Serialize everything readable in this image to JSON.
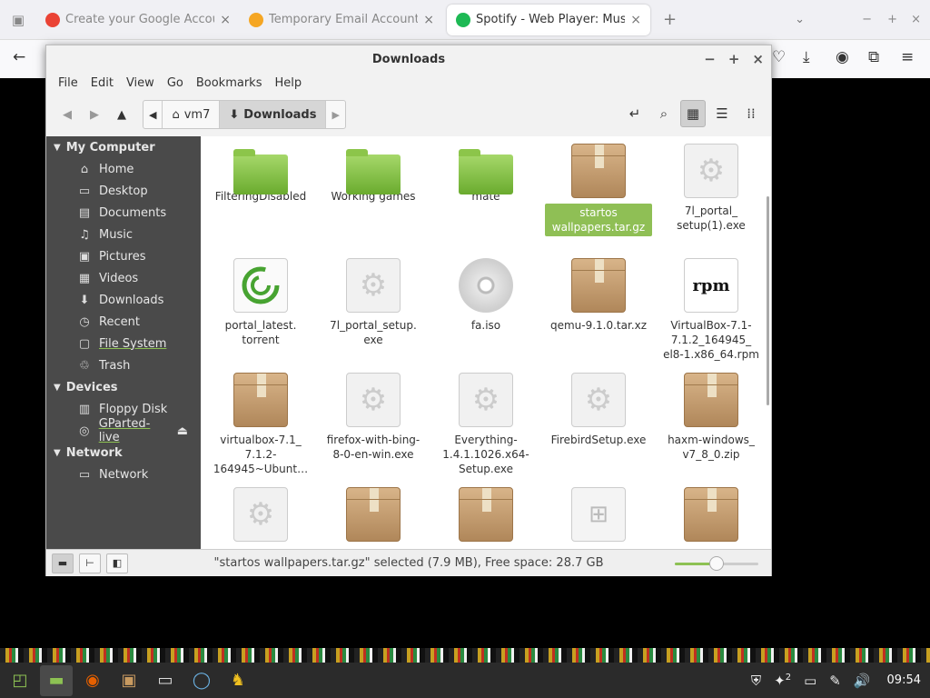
{
  "browser": {
    "tabs": [
      {
        "title": "Create your Google Account",
        "active": false,
        "favicon_color": "#ea4335"
      },
      {
        "title": "Temporary Email Account",
        "active": false,
        "favicon_color": "#f5a623"
      },
      {
        "title": "Spotify - Web Player: Music",
        "active": true,
        "favicon_color": "#1db954"
      }
    ],
    "new_tab": "+"
  },
  "window": {
    "title": "Downloads",
    "controls": {
      "minimize": "−",
      "maximize": "+",
      "close": "×"
    }
  },
  "menu": [
    "File",
    "Edit",
    "View",
    "Go",
    "Bookmarks",
    "Help"
  ],
  "path": {
    "home": "vm7",
    "current": "Downloads"
  },
  "sidebar": {
    "sections": [
      {
        "label": "My Computer",
        "items": [
          {
            "label": "Home",
            "icon": "home-icon",
            "glyph": "⌂"
          },
          {
            "label": "Desktop",
            "icon": "desktop-icon",
            "glyph": "▭"
          },
          {
            "label": "Documents",
            "icon": "documents-icon",
            "glyph": "▤"
          },
          {
            "label": "Music",
            "icon": "music-icon",
            "glyph": "♫"
          },
          {
            "label": "Pictures",
            "icon": "pictures-icon",
            "glyph": "▣"
          },
          {
            "label": "Videos",
            "icon": "videos-icon",
            "glyph": "▦"
          },
          {
            "label": "Downloads",
            "icon": "downloads-icon",
            "glyph": "⬇"
          },
          {
            "label": "Recent",
            "icon": "recent-icon",
            "glyph": "◷"
          },
          {
            "label": "File System",
            "icon": "filesystem-icon",
            "glyph": "▢"
          },
          {
            "label": "Trash",
            "icon": "trash-icon",
            "glyph": "🗑"
          }
        ]
      },
      {
        "label": "Devices",
        "items": [
          {
            "label": "Floppy Disk",
            "icon": "floppy-icon",
            "glyph": "▥"
          },
          {
            "label": "GParted-live",
            "icon": "disc-icon",
            "glyph": "◎"
          }
        ]
      },
      {
        "label": "Network",
        "items": [
          {
            "label": "Network",
            "icon": "network-icon",
            "glyph": "▭"
          }
        ]
      }
    ]
  },
  "files": [
    {
      "name": "FilteringDisabled",
      "type": "folder"
    },
    {
      "name": "Working games",
      "type": "folder"
    },
    {
      "name": "mate",
      "type": "folder"
    },
    {
      "name": "startos wallpapers.tar.gz",
      "type": "archive",
      "selected": true
    },
    {
      "name": "7l_portal_ setup(1).exe",
      "type": "exe"
    },
    {
      "name": "portal_latest. torrent",
      "type": "torrent"
    },
    {
      "name": "7l_portal_setup. exe",
      "type": "exe"
    },
    {
      "name": "fa.iso",
      "type": "iso"
    },
    {
      "name": "qemu-9.1.0.tar.xz",
      "type": "archive"
    },
    {
      "name": "VirtualBox-7.1- 7.1.2_164945_ el8-1.x86_64.rpm",
      "type": "rpm"
    },
    {
      "name": "virtualbox-7.1_ 7.1.2- 164945~Ubunt…",
      "type": "archive"
    },
    {
      "name": "firefox-with-bing- 8-0-en-win.exe",
      "type": "exe"
    },
    {
      "name": "Everything- 1.4.1.1026.x64- Setup.exe",
      "type": "exe"
    },
    {
      "name": "FirebirdSetup.exe",
      "type": "exe"
    },
    {
      "name": "haxm-windows_ v7_8_0.zip",
      "type": "archive"
    },
    {
      "name": "",
      "type": "exe"
    },
    {
      "name": "",
      "type": "archive"
    },
    {
      "name": "",
      "type": "archive"
    },
    {
      "name": "",
      "type": "windows"
    },
    {
      "name": "",
      "type": "archive"
    }
  ],
  "status": {
    "text": "\"startos wallpapers.tar.gz\" selected (7.9 MB), Free space: 28.7 GB",
    "zoom_level": 0.5
  },
  "taskbar": {
    "clock": "09:54",
    "notifications": "2"
  },
  "colors": {
    "accent": "#8dc153",
    "sidebar": "#4a4a4a",
    "selection": "#8fbf55"
  }
}
